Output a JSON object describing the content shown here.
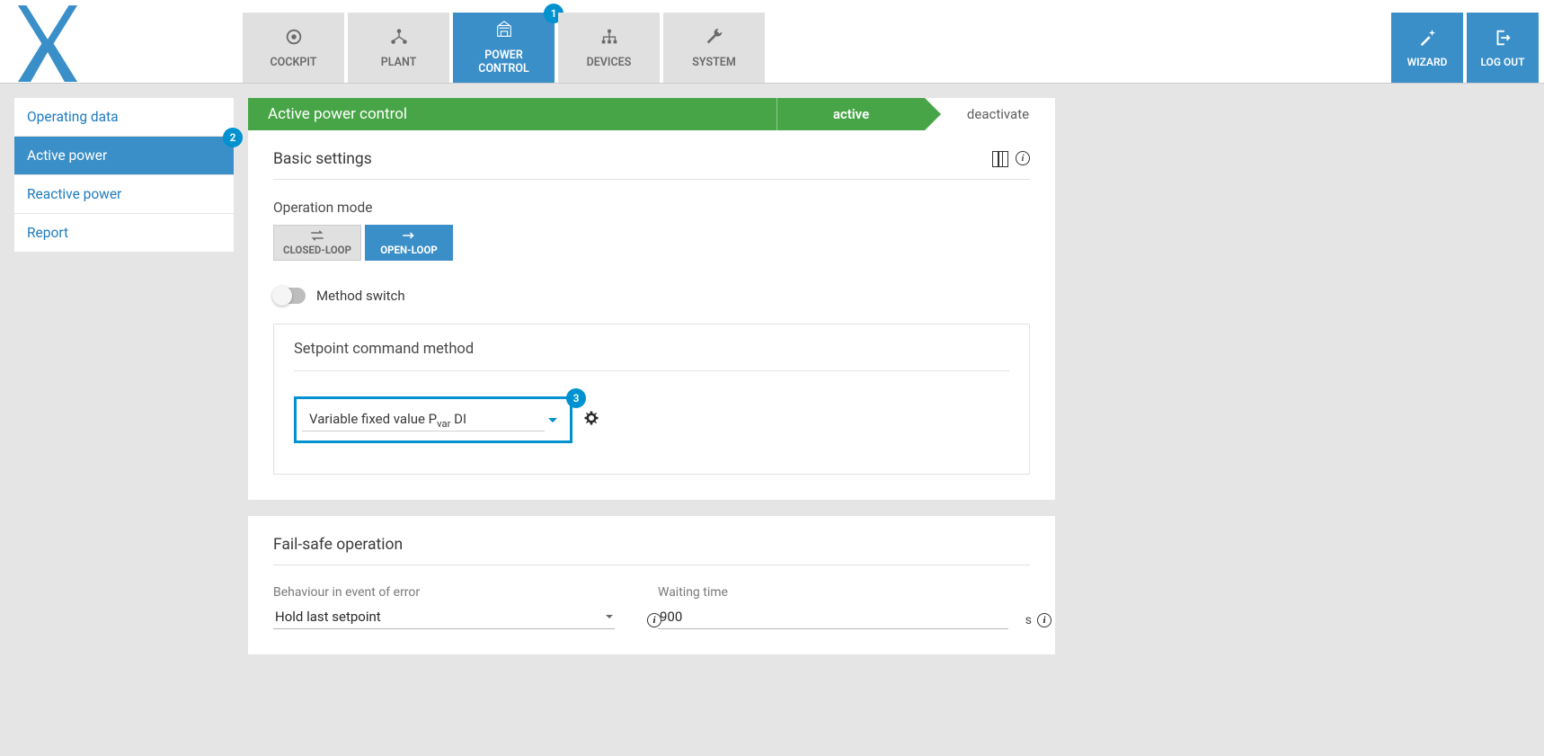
{
  "nav": {
    "tabs": [
      {
        "label": "COCKPIT"
      },
      {
        "label": "PLANT"
      },
      {
        "label": "POWER\nCONTROL"
      },
      {
        "label": "DEVICES"
      },
      {
        "label": "SYSTEM"
      }
    ],
    "wizard": "WIZARD",
    "logout": "LOG OUT"
  },
  "badges": {
    "b1": "1",
    "b2": "2",
    "b3": "3"
  },
  "sidebar": {
    "items": [
      {
        "label": "Operating data"
      },
      {
        "label": "Active power"
      },
      {
        "label": "Reactive power"
      },
      {
        "label": "Report"
      }
    ]
  },
  "header": {
    "title": "Active power control",
    "active": "active",
    "deactivate": "deactivate"
  },
  "basic": {
    "title": "Basic settings",
    "operation_mode_label": "Operation mode",
    "closed_loop": "CLOSED-LOOP",
    "open_loop": "OPEN-LOOP",
    "method_switch_label": "Method switch",
    "setpoint_title": "Setpoint command method",
    "setpoint_value_pre": "Variable fixed value P",
    "setpoint_value_sub": "var",
    "setpoint_value_post": " DI"
  },
  "failsafe": {
    "title": "Fail-safe operation",
    "behaviour_label": "Behaviour in event of error",
    "behaviour_value": "Hold last setpoint",
    "waiting_label": "Waiting time",
    "waiting_value": "900",
    "waiting_unit": "s"
  }
}
